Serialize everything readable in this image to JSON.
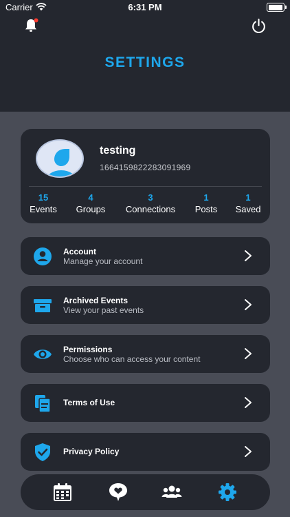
{
  "status_bar": {
    "carrier": "Carrier",
    "time": "6:31 PM"
  },
  "header": {
    "title": "SETTINGS"
  },
  "profile": {
    "name": "testing",
    "id": "1664159822283091969",
    "stats": [
      {
        "count": "15",
        "label": "Events"
      },
      {
        "count": "4",
        "label": "Groups"
      },
      {
        "count": "3",
        "label": "Connections"
      },
      {
        "count": "1",
        "label": "Posts"
      },
      {
        "count": "1",
        "label": "Saved"
      }
    ]
  },
  "menu": [
    {
      "title": "Account",
      "subtitle": "Manage your account",
      "icon": "user-circle-icon"
    },
    {
      "title": "Archived Events",
      "subtitle": "View your past events",
      "icon": "archive-box-icon"
    },
    {
      "title": "Permissions",
      "subtitle": "Choose who can access your content",
      "icon": "eye-icon"
    },
    {
      "title": "Terms of Use",
      "subtitle": "",
      "icon": "documents-icon"
    },
    {
      "title": "Privacy Policy",
      "subtitle": "",
      "icon": "shield-check-icon"
    }
  ],
  "bottom_nav": [
    {
      "icon": "calendar-icon"
    },
    {
      "icon": "heart-chat-icon"
    },
    {
      "icon": "users-icon"
    },
    {
      "icon": "gear-icon",
      "active": true
    }
  ],
  "colors": {
    "accent": "#1ea7ec",
    "card": "#24272f",
    "background": "#494c56",
    "notification_dot": "#ff3b30"
  }
}
